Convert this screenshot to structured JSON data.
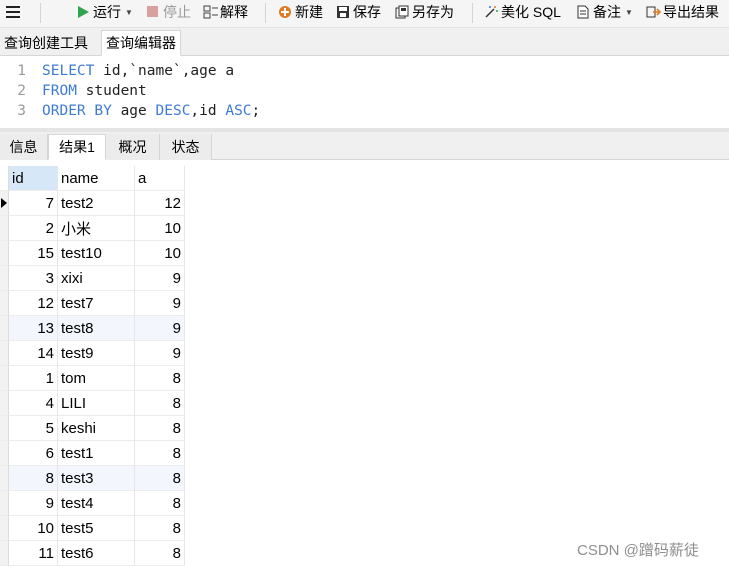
{
  "toolbar": {
    "run_label": "运行",
    "stop_label": "停止",
    "explain_label": "解释",
    "new_label": "新建",
    "save_label": "保存",
    "save_as_label": "另存为",
    "beautify_label": "美化 SQL",
    "note_label": "备注",
    "export_label": "导出结果"
  },
  "editor_tabs": [
    "查询创建工具",
    "查询编辑器"
  ],
  "sql": {
    "line_numbers": [
      "1",
      "2",
      "3"
    ],
    "line1": {
      "kw1": "SELECT",
      "rest": " id,`name`,age a"
    },
    "line2": {
      "kw1": "FROM",
      "rest": " student"
    },
    "line3": {
      "kw1": "ORDER BY",
      "mid1": " age ",
      "kw2": "DESC",
      "mid2": ",id ",
      "kw3": "ASC",
      "end": ";"
    }
  },
  "result_tabs": [
    "信息",
    "结果1",
    "概况",
    "状态"
  ],
  "grid": {
    "columns": [
      "id",
      "name",
      "a"
    ],
    "rows": [
      {
        "id": "7",
        "name": "test2",
        "a": "12"
      },
      {
        "id": "2",
        "name": "小米",
        "a": "10"
      },
      {
        "id": "15",
        "name": "test10",
        "a": "10"
      },
      {
        "id": "3",
        "name": "xixi",
        "a": "9"
      },
      {
        "id": "12",
        "name": "test7",
        "a": "9"
      },
      {
        "id": "13",
        "name": "test8",
        "a": "9"
      },
      {
        "id": "14",
        "name": "test9",
        "a": "9"
      },
      {
        "id": "1",
        "name": "tom",
        "a": "8"
      },
      {
        "id": "4",
        "name": "LILI",
        "a": "8"
      },
      {
        "id": "5",
        "name": "keshi",
        "a": "8"
      },
      {
        "id": "6",
        "name": "test1",
        "a": "8"
      },
      {
        "id": "8",
        "name": "test3",
        "a": "8"
      },
      {
        "id": "9",
        "name": "test4",
        "a": "8"
      },
      {
        "id": "10",
        "name": "test5",
        "a": "8"
      },
      {
        "id": "11",
        "name": "test6",
        "a": "8"
      }
    ]
  },
  "watermark": "CSDN @蹭码薪徒",
  "colors": {
    "keyword": "#3d7bd6",
    "run_icon": "#2ea44f",
    "stop_icon": "#d97a7a",
    "export_icon": "#e07b24"
  }
}
